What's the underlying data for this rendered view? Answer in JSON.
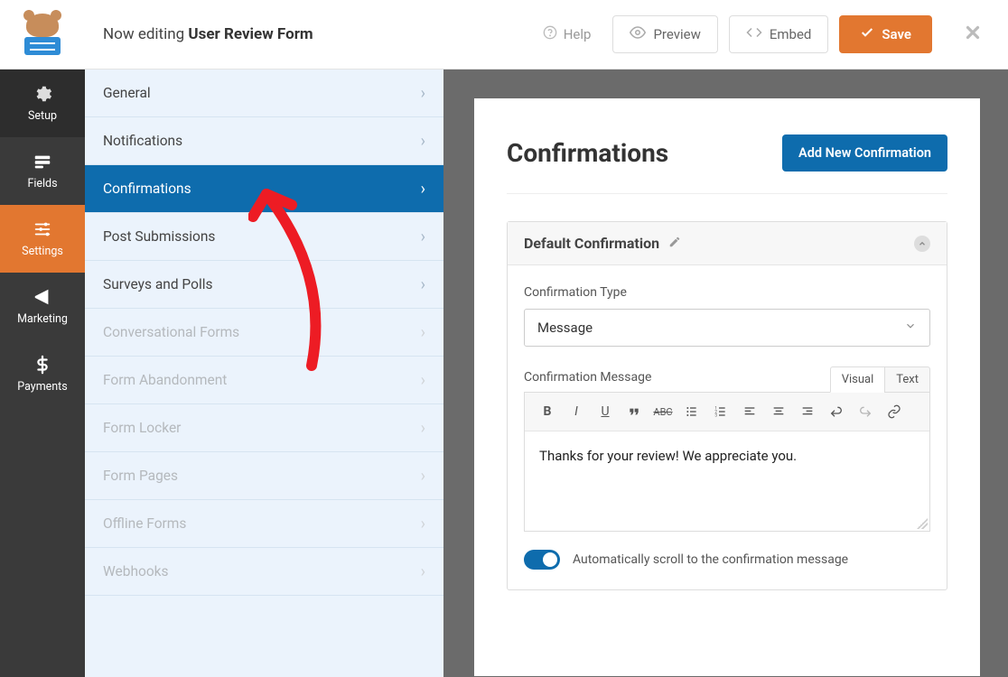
{
  "header": {
    "editing_prefix": "Now editing ",
    "form_name": "User Review Form",
    "help": "Help",
    "preview": "Preview",
    "embed": "Embed",
    "save": "Save"
  },
  "rail": {
    "setup": "Setup",
    "fields": "Fields",
    "settings": "Settings",
    "marketing": "Marketing",
    "payments": "Payments"
  },
  "submenu": {
    "general": "General",
    "notifications": "Notifications",
    "confirmations": "Confirmations",
    "post_submissions": "Post Submissions",
    "surveys": "Surveys and Polls",
    "conversational": "Conversational Forms",
    "abandonment": "Form Abandonment",
    "locker": "Form Locker",
    "pages": "Form Pages",
    "offline": "Offline Forms",
    "webhooks": "Webhooks"
  },
  "panel": {
    "title": "Confirmations",
    "add_button": "Add New Confirmation",
    "card_title": "Default Confirmation",
    "type_label": "Confirmation Type",
    "type_value": "Message",
    "message_label": "Confirmation Message",
    "tab_visual": "Visual",
    "tab_text": "Text",
    "message_value": "Thanks for your review! We appreciate you.",
    "toggle_label": "Automatically scroll to the confirmation message"
  }
}
